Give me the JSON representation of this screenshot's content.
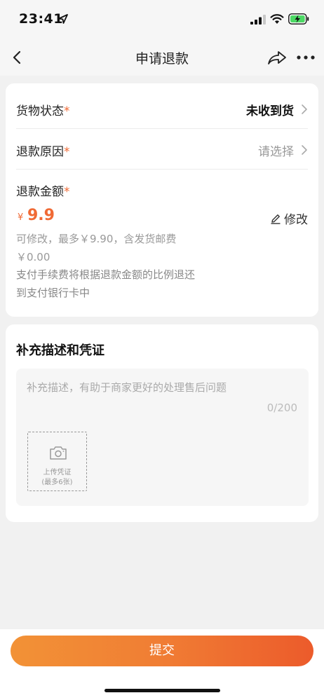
{
  "status_bar": {
    "time": "23:41",
    "icons": [
      "location-arrow-icon",
      "signal-icon",
      "wifi-icon",
      "battery-charging-icon"
    ]
  },
  "nav": {
    "title": "申请退款",
    "back_icon": "back-chevron-icon",
    "share_icon": "share-icon",
    "more_icon": "more-icon"
  },
  "refund_form": {
    "goods_status": {
      "label": "货物状态",
      "required_mark": "*",
      "value": "未收到货"
    },
    "refund_reason": {
      "label": "退款原因",
      "required_mark": "*",
      "value": "请选择"
    },
    "refund_amount": {
      "label": "退款金额",
      "required_mark": "*",
      "currency": "¥",
      "value": "9.9",
      "edit_label": "修改",
      "note_max": "可修改，最多￥9.90，含发货邮费",
      "note_fee": "￥0.00",
      "note_line1": "支付手续费将根据退款金额的比例退还",
      "note_line2": "到支付银行卡中"
    }
  },
  "evidence": {
    "title": "补充描述和凭证",
    "placeholder": "补充描述，有助于商家更好的处理售后问题",
    "counter": "0/200",
    "upload_label": "上传凭证",
    "upload_limit": "(最多6张)"
  },
  "footer": {
    "submit_label": "提交"
  },
  "colors": {
    "accent": "#f06a35",
    "gradient_start": "#f29236",
    "gradient_end": "#ec5b2b"
  }
}
